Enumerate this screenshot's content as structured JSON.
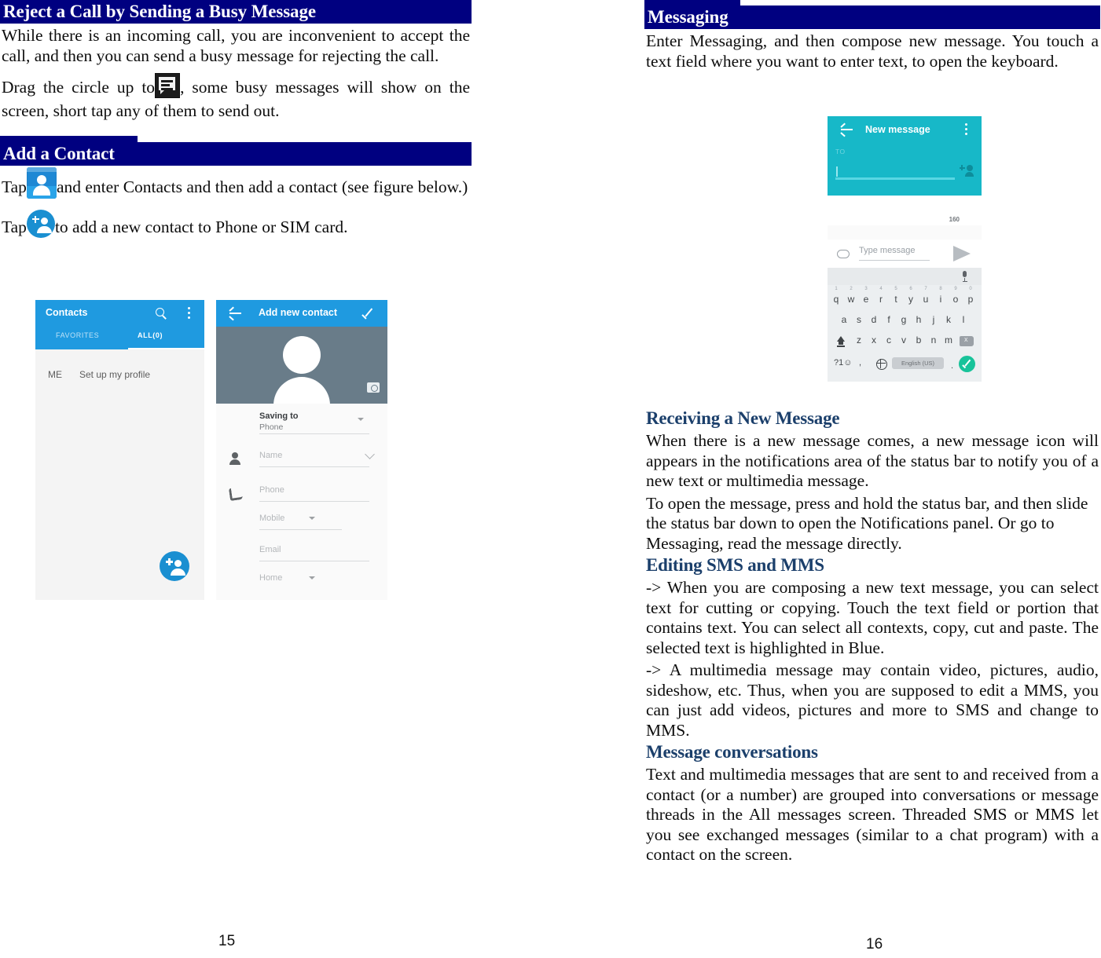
{
  "document": {
    "left_page": {
      "page_number": "15",
      "sections": [
        {
          "heading": "Reject a Call by Sending a Busy Message",
          "paragraphs": [
            "While there is an incoming call, you are inconvenient to accept the call, and then you can send a busy message for rejecting the call.",
            "Drag the circle up to",
            ", some busy messages will show on the screen, short tap any of them to send out."
          ]
        },
        {
          "heading": "Add a Contact",
          "paragraphs": [
            "Tap",
            "and enter Contacts and then add a contact (see figure below.)",
            "Tap",
            "to add a new contact to Phone or SIM card."
          ]
        }
      ]
    },
    "right_page": {
      "page_number": "16",
      "sections": [
        {
          "heading": "Messaging",
          "paragraphs": [
            "Enter Messaging, and then compose new message. You touch a text field where you want to enter text, to open the keyboard."
          ]
        },
        {
          "subheading": "Receiving a New Message",
          "paragraphs": [
            "When there is a new message comes, a new message icon will appears in the notifications area of the status bar to notify you of a new text or multimedia message.",
            "To open the message, press and hold the status bar, and then slide the status bar down to open the Notifications panel. Or go to Messaging, read the message directly."
          ]
        },
        {
          "subheading": "Editing SMS and MMS",
          "paragraphs": [
            "-> When you are composing a new text message, you can select text for cutting or copying. Touch the text field or portion that contains text. You can select all contexts, copy, cut and paste. The selected text is highlighted in Blue.",
            "-> A multimedia message may contain video, pictures, audio, sideshow, etc. Thus, when you are supposed to edit a MMS, you can just add videos, pictures and more to SMS and change to MMS."
          ]
        },
        {
          "subheading": "Message conversations",
          "paragraphs": [
            "Text and multimedia messages that are sent to and received from a contact (or a number) are grouped into conversations or message threads in the All messages screen. Threaded SMS or MMS let you see exchanged messages (similar to a chat program) with a contact on the screen."
          ]
        }
      ]
    }
  },
  "inline_icons": {
    "busy_message": "busy-message-icon",
    "contacts_app": "contacts-app-icon",
    "add_contact_fab": "add-contact-fab-icon"
  },
  "screenshots": {
    "contacts": {
      "title": "Contacts",
      "tabs": [
        "FAVORITES",
        "ALL(0)"
      ],
      "me_label": "ME",
      "me_text": "Set up my profile",
      "search_icon": "search-icon",
      "overflow_icon": "kebab-menu-icon",
      "fab_icon": "add-contact-fab-icon",
      "appbar_color": "#1f9ae0"
    },
    "add_new_contact": {
      "title": "Add new contact",
      "back_icon": "back-arrow-icon",
      "confirm_icon": "check-icon",
      "camera_icon": "camera-icon",
      "fields": [
        {
          "label": "Saving to",
          "value": "Phone",
          "icon": "account-circle-icon"
        },
        {
          "label": "Name",
          "value": "",
          "icon": "person-icon"
        },
        {
          "label": "Phone",
          "value": "",
          "icon": "phone-icon"
        },
        {
          "label": "Mobile",
          "value": "",
          "icon": ""
        },
        {
          "label": "Email",
          "value": "",
          "icon": "mail-icon"
        },
        {
          "label": "Home",
          "value": "",
          "icon": ""
        }
      ],
      "appbar_color": "#1f9ae0"
    },
    "new_message": {
      "title": "New message",
      "back_icon": "back-arrow-icon",
      "overflow_icon": "kebab-menu-icon",
      "to_label": "TO",
      "add_contact_icon": "add-contact-icon",
      "char_counter": "160",
      "attach_icon": "attachment-icon",
      "compose_placeholder": "Type message",
      "send_icon": "send-icon",
      "mic_icon": "microphone-icon",
      "appbar_color": "#17b8c8",
      "keyboard": {
        "row1_numbers": [
          "1",
          "2",
          "3",
          "4",
          "5",
          "6",
          "7",
          "8",
          "9",
          "0"
        ],
        "row1": [
          "q",
          "w",
          "e",
          "r",
          "t",
          "y",
          "u",
          "i",
          "o",
          "p"
        ],
        "row2": [
          "a",
          "s",
          "d",
          "f",
          "g",
          "h",
          "j",
          "k",
          "l"
        ],
        "row3": [
          "z",
          "x",
          "c",
          "v",
          "b",
          "n",
          "m"
        ],
        "shift_icon": "shift-icon",
        "backspace_icon": "backspace-icon",
        "symbols_key": "?1☺",
        "comma_key": ",",
        "globe_icon": "language-globe-icon",
        "space_label": "English (US)",
        "period_key": ".",
        "enter_icon": "check-enter-icon"
      }
    }
  },
  "colors": {
    "section_bar": "#000080",
    "subheading": "#1b3f6b",
    "contacts_accent": "#1f9ae0",
    "messaging_accent": "#17b8c8",
    "keyboard_enter": "#18c39a"
  }
}
